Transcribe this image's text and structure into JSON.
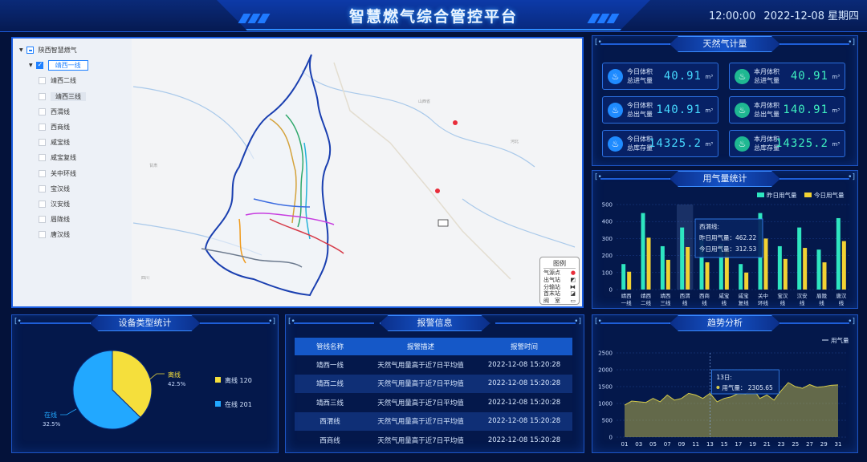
{
  "header": {
    "title": "智慧燃气综合管控平台",
    "time": "12:00:00",
    "date": "2022-12-08",
    "weekday": "星期四"
  },
  "tree": {
    "root": "陕西智慧燃气",
    "items": [
      "靖西一线",
      "靖西二线",
      "靖西三线",
      "西渭线",
      "西商线",
      "咸宝线",
      "咸宝复线",
      "关中环线",
      "宝汉线",
      "汉安线",
      "眉陇线",
      "唐汉线"
    ]
  },
  "map_legend": {
    "title": "图例",
    "items": [
      "气源点",
      "出气站",
      "分输站",
      "首末站",
      "阀　室"
    ]
  },
  "panels": {
    "gas": "天然气计量",
    "usage": "用气量统计",
    "device": "设备类型统计",
    "alarm": "报警信息",
    "trend": "趋势分析"
  },
  "gas_cards": [
    {
      "label1": "今日体积",
      "label2": "总进气量",
      "value": "40.91",
      "unit": "m³"
    },
    {
      "label1": "本月体积",
      "label2": "总进气量",
      "value": "40.91",
      "unit": "m³"
    },
    {
      "label1": "今日体积",
      "label2": "总出气量",
      "value": "140.91",
      "unit": "m³"
    },
    {
      "label1": "本月体积",
      "label2": "总出气量",
      "value": "140.91",
      "unit": "m³"
    },
    {
      "label1": "今日体积",
      "label2": "总库存量",
      "value": "14325.2",
      "unit": "m³"
    },
    {
      "label1": "本月体积",
      "label2": "总库存量",
      "value": "14325.2",
      "unit": "m³"
    }
  ],
  "colors": {
    "yesterday": "#2ee6c0",
    "today": "#f2d233",
    "online": "#22a8ff",
    "offline": "#f5df3c",
    "trend": "#d6cc4a"
  },
  "chart_data": [
    {
      "type": "bar",
      "categories": [
        "靖西一线",
        "靖西二线",
        "靖西三线",
        "西渭线",
        "西商线",
        "咸宝线",
        "咸宝复线",
        "关中环线",
        "宝汉线",
        "汉安线",
        "眉陇线",
        "唐汉线"
      ],
      "category_lines": [
        [
          "靖西",
          "一线"
        ],
        [
          "靖西",
          "二线"
        ],
        [
          "靖西",
          "三线"
        ],
        [
          "西渭",
          "线"
        ],
        [
          "西商",
          "线"
        ],
        [
          "咸宝",
          "线"
        ],
        [
          "咸宝",
          "复线"
        ],
        [
          "关中",
          "环线"
        ],
        [
          "宝汉",
          "线"
        ],
        [
          "汉安",
          "线"
        ],
        [
          "眉陇",
          "线"
        ],
        [
          "唐汉",
          "线"
        ]
      ],
      "series": [
        {
          "name": "昨日用气量",
          "values": [
            150,
            450,
            255,
            365,
            290,
            270,
            150,
            450,
            255,
            365,
            235,
            420
          ]
        },
        {
          "name": "今日用气量",
          "values": [
            105,
            305,
            175,
            250,
            160,
            230,
            100,
            300,
            180,
            245,
            160,
            285
          ]
        }
      ],
      "ylim": [
        0,
        500
      ],
      "yticks": [
        0,
        100,
        200,
        300,
        400,
        500
      ],
      "legend": "top-right",
      "tooltip": {
        "title": "西渭线:",
        "rows": [
          "昨日用气量：462.22",
          "今日用气量：312.53"
        ]
      }
    },
    {
      "type": "pie",
      "labels": [
        "离线",
        "在线"
      ],
      "values": [
        120,
        201
      ],
      "percent_labels": [
        "42.5%",
        "32.5%"
      ],
      "legend_items": [
        "离线 120",
        "在线 201"
      ],
      "legend": "right"
    },
    {
      "type": "area",
      "series": [
        {
          "name": "用气量",
          "values": [
            950,
            1070,
            1050,
            1030,
            1150,
            1050,
            1250,
            1100,
            1150,
            1300,
            1250,
            1150,
            1300,
            1050,
            1150,
            1200,
            1300,
            1280,
            1450,
            1150,
            1250,
            1100,
            1380,
            1620,
            1500,
            1450,
            1560,
            1480,
            1500,
            1540,
            1550
          ]
        }
      ],
      "x": [
        "01",
        "02",
        "03",
        "04",
        "05",
        "06",
        "07",
        "08",
        "09",
        "10",
        "11",
        "12",
        "13",
        "14",
        "15",
        "16",
        "17",
        "18",
        "19",
        "20",
        "21",
        "22",
        "23",
        "24",
        "25",
        "26",
        "27",
        "28",
        "29",
        "30",
        "31"
      ],
      "xtick_labels": [
        "01",
        "03",
        "05",
        "07",
        "09",
        "11",
        "13",
        "15",
        "17",
        "19",
        "21",
        "23",
        "25",
        "27",
        "29",
        "31"
      ],
      "ylim": [
        0,
        2500
      ],
      "yticks": [
        0,
        500,
        1000,
        1500,
        2000,
        2500
      ],
      "legend": "top-right",
      "tooltip": {
        "title": "13日:",
        "row": "用气量： 2305.65"
      }
    }
  ],
  "alarm": {
    "headers": [
      "管线名称",
      "报警描述",
      "报警时间"
    ],
    "rows": [
      [
        "靖西一线",
        "天然气用量高于近7日平均值",
        "2022-12-08 15:20:28"
      ],
      [
        "靖西二线",
        "天然气用量高于近7日平均值",
        "2022-12-08 15:20:28"
      ],
      [
        "靖西三线",
        "天然气用量高于近7日平均值",
        "2022-12-08 15:20:28"
      ],
      [
        "西渭线",
        "天然气用量高于近7日平均值",
        "2022-12-08 15:20:28"
      ],
      [
        "西商线",
        "天然气用量高于近7日平均值",
        "2022-12-08 15:20:28"
      ]
    ]
  }
}
